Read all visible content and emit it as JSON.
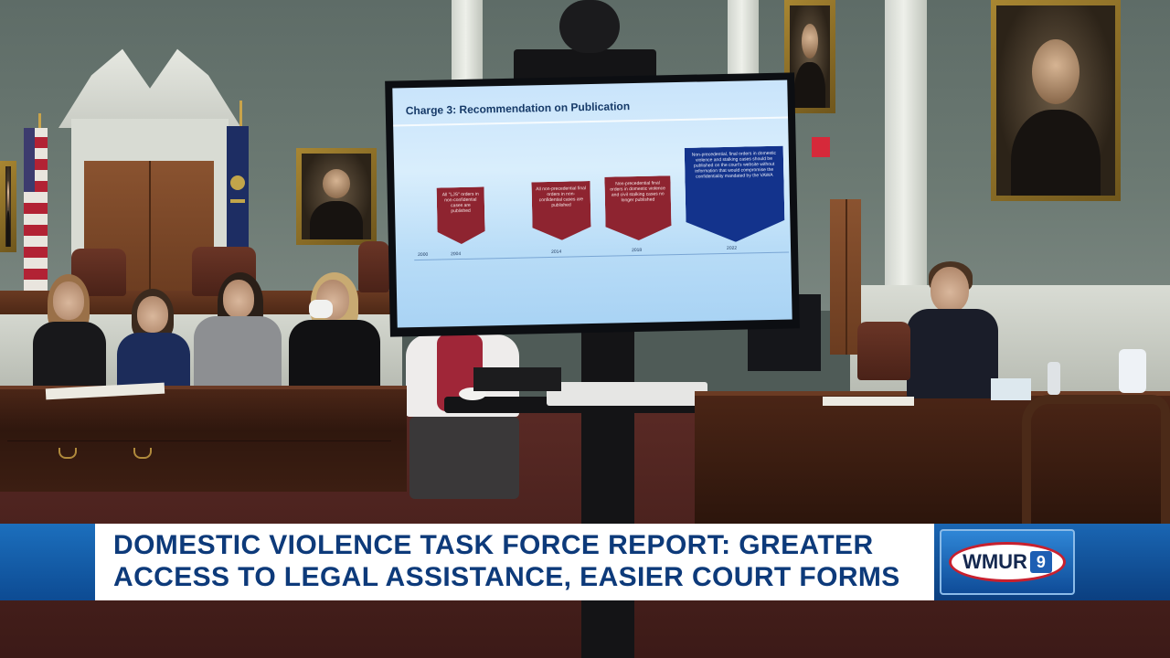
{
  "slide": {
    "title": "Charge 3: Recommendation on Publication",
    "steps": [
      {
        "text": "All \"LJS\" orders in non-confidential cases are published",
        "year": "2004"
      },
      {
        "text": "All non-precedential final orders in non-confidential cases are published",
        "year": "2014"
      },
      {
        "text": "Non-precedential final orders in domestic violence and civil stalking cases no longer published",
        "year": "2018"
      },
      {
        "text": "Non-precedential, final orders in domestic violence and stalking cases should be published on the court's website without information that would compromise the confidentiality mandated by the VAWA",
        "year": "2022"
      }
    ],
    "start_year": "2000"
  },
  "lower_third": {
    "line1": "DOMESTIC VIOLENCE TASK FORCE REPORT:  GREATER",
    "line2": "ACCESS TO LEGAL ASSISTANCE, EASIER COURT FORMS",
    "station_logo": "WMUR",
    "channel_number": "9"
  },
  "colors": {
    "headline_text": "#0d3a7a",
    "bar_blue": "#0d4b93",
    "slide_red": "#8e2430",
    "slide_blue": "#13338c"
  }
}
